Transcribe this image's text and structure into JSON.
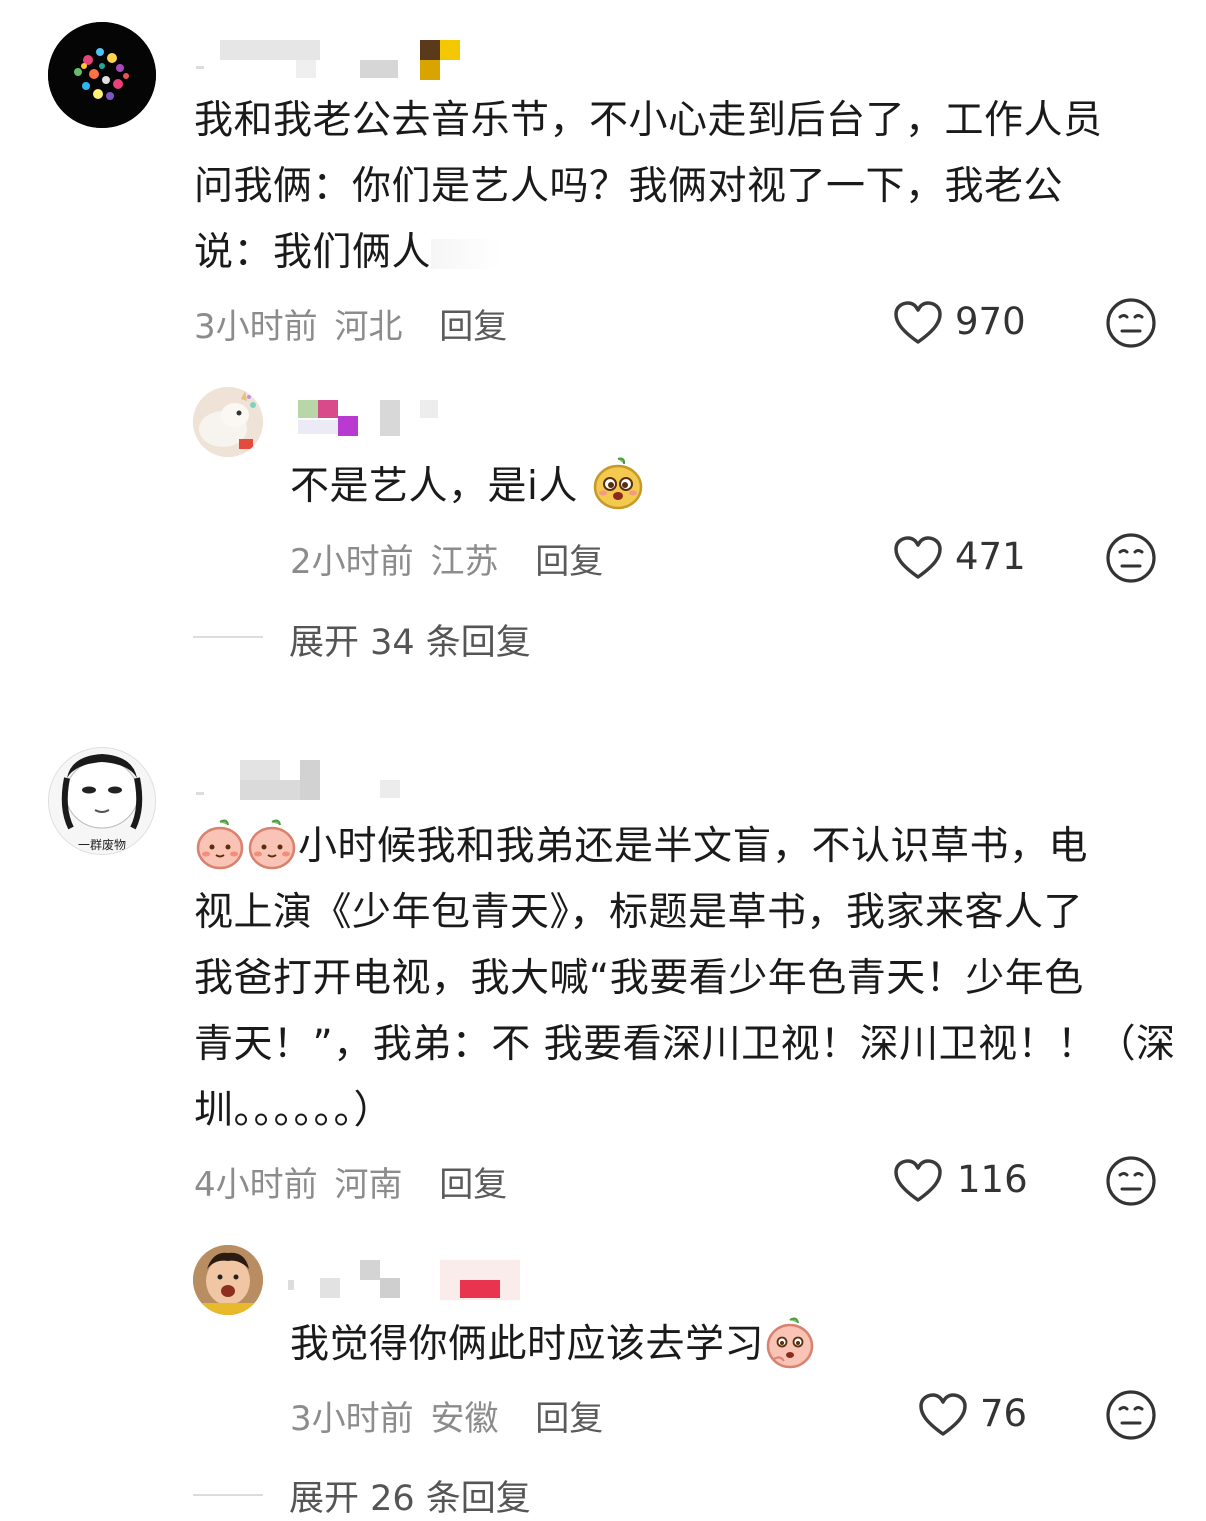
{
  "comments": [
    {
      "text_lines": [
        "我和我老公去音乐节，不小心走到后台了，工作人员",
        "问我俩：你们是艺人吗？我俩对视了一下，我老公",
        "说：我们俩人"
      ],
      "time": "3小时前",
      "location": "河北",
      "reply_label": "回复",
      "likes": "970",
      "reply": {
        "text": "不是艺人，是i人",
        "time": "2小时前",
        "location": "江苏",
        "reply_label": "回复",
        "likes": "471"
      },
      "expand_label": "展开 34 条回复"
    },
    {
      "text_lines": [
        "小时候我和我弟还是半文盲，不认识草书，电",
        "视上演《少年包青天》，标题是草书，我家来客人了",
        "我爸打开电视，我大喊“我要看少年色青天！少年色",
        "青天！”，我弟：不 我要看深川卫视！深川卫视！！（深",
        "圳。。。。。。）"
      ],
      "avatar_caption": "一群废物",
      "time": "4小时前",
      "location": "河南",
      "reply_label": "回复",
      "likes": "116",
      "reply": {
        "text": "我觉得你俩此时应该去学习",
        "time": "3小时前",
        "location": "安徽",
        "reply_label": "回复",
        "likes": "76"
      },
      "expand_label": "展开 26 条回复"
    }
  ],
  "icons": {
    "like": "heart-outline-icon",
    "dislike": "meh-face-icon",
    "emoji": "peach-sticker-icon"
  },
  "colors": {
    "text": "#1a1a1a",
    "meta": "#8c8c8c",
    "peach": "#f6b6a8",
    "mango": "#f2c44c"
  }
}
